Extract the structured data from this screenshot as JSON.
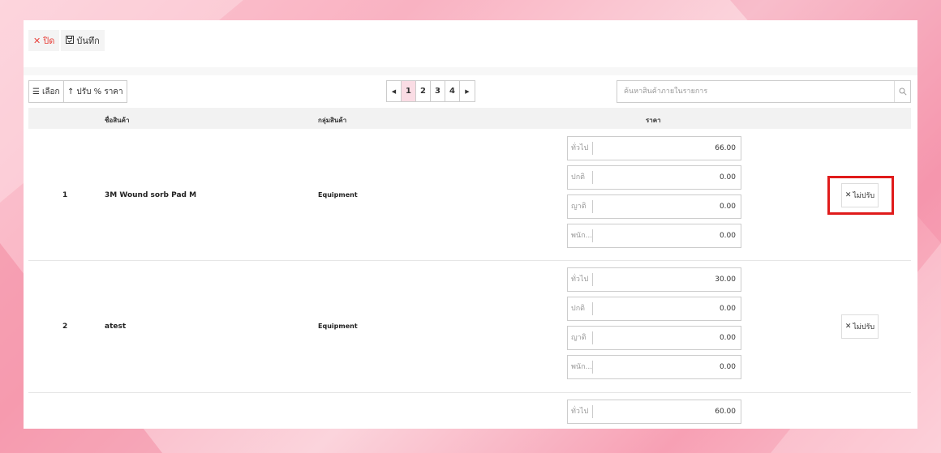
{
  "toolbar": {
    "close_label": "ปิด",
    "save_label": "บันทึก"
  },
  "controls": {
    "select_label": "เลือก",
    "adjust_label": "ปรับ % ราคา",
    "search_placeholder": "ค้นหาสินค้าภายในรายการ"
  },
  "pagination": {
    "prev": "◀",
    "next": "▶",
    "pages": [
      "1",
      "2",
      "3",
      "4"
    ],
    "current": "1"
  },
  "table": {
    "headers": {
      "name": "ชื่อสินค้า",
      "group": "กลุ่มสินค้า",
      "price": "ราคา"
    },
    "rows": [
      {
        "index": "1",
        "name": "3M Wound sorb Pad M",
        "group": "Equipment",
        "prices": [
          {
            "label": "ทั่วไป",
            "value": "66.00"
          },
          {
            "label": "ปกติ",
            "value": "0.00"
          },
          {
            "label": "ญาติ",
            "value": "0.00"
          },
          {
            "label": "พนัก...",
            "value": "0.00"
          }
        ],
        "action": "ไม่ปรับ"
      },
      {
        "index": "2",
        "name": "atest",
        "group": "Equipment",
        "prices": [
          {
            "label": "ทั่วไป",
            "value": "30.00"
          },
          {
            "label": "ปกติ",
            "value": "0.00"
          },
          {
            "label": "ญาติ",
            "value": "0.00"
          },
          {
            "label": "พนัก...",
            "value": "0.00"
          }
        ],
        "action": "ไม่ปรับ"
      },
      {
        "index": "",
        "name": "",
        "group": "",
        "prices": [
          {
            "label": "ทั่วไป",
            "value": "60.00"
          }
        ],
        "action": ""
      }
    ]
  },
  "colors": {
    "highlight": "#e01b1b",
    "active_page": "#fadce4",
    "close": "#e8433d"
  }
}
